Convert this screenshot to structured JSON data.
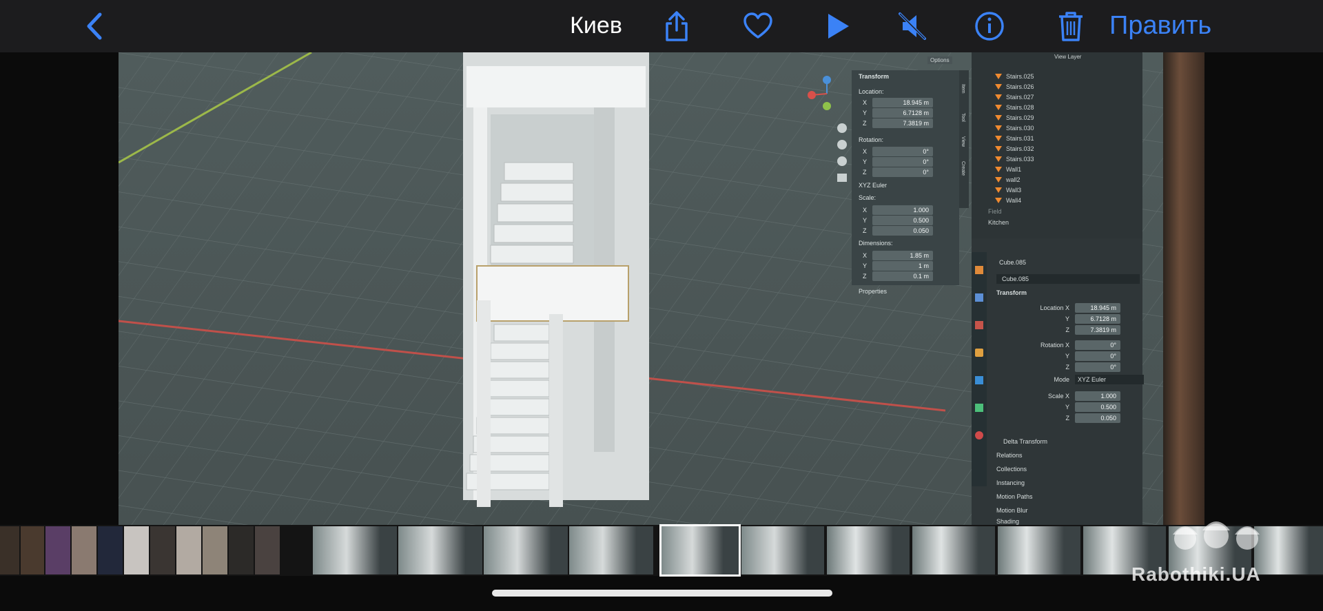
{
  "toolbar": {
    "title": "Киев",
    "edit_label": "Править",
    "icons": [
      "back-chevron-icon",
      "share-icon",
      "heart-icon",
      "play-icon",
      "mute-icon",
      "info-icon",
      "trash-icon"
    ],
    "accent_color": "#3b82f6"
  },
  "npanel": {
    "header": "Transform",
    "location_label": "Location:",
    "location": {
      "x": "18.945 m",
      "y": "6.7128 m",
      "z": "7.3819 m"
    },
    "rotation_label": "Rotation:",
    "rotation": {
      "x": "0°",
      "y": "0°",
      "z": "0°"
    },
    "rotation_mode": "XYZ Euler",
    "scale_label": "Scale:",
    "scale": {
      "x": "1.000",
      "y": "0.500",
      "z": "0.050"
    },
    "dimensions_label": "Dimensions:",
    "dimensions": {
      "x": "1.85 m",
      "y": "1 m",
      "z": "0.1 m"
    },
    "properties_label": "Properties",
    "options_label": "Options",
    "tabs": [
      "Item",
      "Tool",
      "View",
      "Create"
    ]
  },
  "outliner": {
    "header": "View Layer",
    "items": [
      "Stairs.025",
      "Stairs.026",
      "Stairs.027",
      "Stairs.028",
      "Stairs.029",
      "Stairs.030",
      "Stairs.031",
      "Stairs.032",
      "Stairs.033",
      "Wall1",
      "wall2",
      "Wall3",
      "Wall4",
      "Field",
      "Kitchen"
    ]
  },
  "properties": {
    "object_name": "Cube.085",
    "mesh_name": "Cube.085",
    "transform_header": "Transform",
    "location_x_label": "Location X",
    "location": [
      "18.945 m",
      "6.7128 m",
      "7.3819 m"
    ],
    "rotation_x_label": "Rotation X",
    "rotation": [
      "0°",
      "0°",
      "0°"
    ],
    "mode_label": "Mode",
    "mode_value": "XYZ Euler",
    "scale_x_label": "Scale X",
    "scale": [
      "1.000",
      "0.500",
      "0.050"
    ],
    "axis_y": "Y",
    "axis_z": "Z",
    "sections": [
      "Delta Transform",
      "Relations",
      "Collections",
      "Instancing",
      "Motion Paths",
      "Motion Blur",
      "Shading"
    ]
  },
  "watermark": "Rabothiki.UA"
}
